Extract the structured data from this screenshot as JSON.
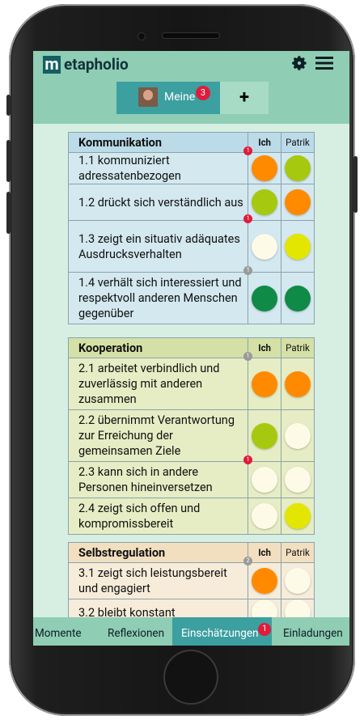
{
  "app": {
    "logo_letter": "m",
    "logo_text": "etapholio",
    "icons": {
      "settings": "gear-icon",
      "menu": "hamburger-icon",
      "avatar": "user-avatar"
    }
  },
  "tabs": {
    "meine_label": "Meine",
    "meine_badge": "3",
    "add_label": "+"
  },
  "colors": {
    "orange": "#ff8a00",
    "yellowgreen": "#a6c90f",
    "green": "#0f8a47",
    "yellow": "#e3e600",
    "empty": "#fdfbe8",
    "badge_red": "#e01b3c",
    "badge_grey": "#9a9a9a"
  },
  "sections": [
    {
      "title": "Kommunikation",
      "col_ich": "Ich",
      "col_other": "Patrik",
      "bg": "#d3e8ef",
      "header_bg": "#bcdbe8",
      "items": [
        {
          "text": "1.1 kommuniziert adressatenbezogen",
          "badge": "1",
          "badge_color": "red",
          "ich": "orange",
          "other": "yellowgreen"
        },
        {
          "text": "1.2 drückt sich verständlich aus",
          "badge": "",
          "badge_color": "",
          "ich": "yellowgreen",
          "other": "orange"
        },
        {
          "text": "1.3 zeigt ein situativ adäquates Ausdrucksverhalten",
          "badge": "1",
          "badge_color": "red",
          "ich": "empty",
          "other": "yellow"
        },
        {
          "text": "1.4 verhält sich interessiert und respektvoll anderen Menschen gegenüber",
          "badge": "1",
          "badge_color": "grey",
          "ich": "green",
          "other": "green"
        }
      ]
    },
    {
      "title": "Kooperation",
      "col_ich": "Ich",
      "col_other": "Patrik",
      "bg": "#e6edc4",
      "header_bg": "#d5e0a6",
      "items": [
        {
          "text": "2.1 arbeitet verbindlich und zuverlässig mit anderen zusammen",
          "badge": "1",
          "badge_color": "grey",
          "ich": "orange",
          "other": "orange"
        },
        {
          "text": "2.2 übernimmt Verantwortung zur Erreichung der gemeinsamen Ziele",
          "badge": "",
          "badge_color": "",
          "ich": "yellowgreen",
          "other": "empty"
        },
        {
          "text": "2.3 kann sich in andere Personen hineinversetzen",
          "badge": "1",
          "badge_color": "red",
          "ich": "empty",
          "other": "empty"
        },
        {
          "text": "2.4 zeigt sich offen und kompromissbereit",
          "badge": "",
          "badge_color": "",
          "ich": "empty",
          "other": "yellow"
        }
      ]
    },
    {
      "title": "Selbstregulation",
      "col_ich": "Ich",
      "col_other": "Patrik",
      "bg": "#f6ecd9",
      "header_bg": "#f2dfc0",
      "items": [
        {
          "text": "3.1 zeigt sich leistungsbereit und engagiert",
          "badge": "2",
          "badge_color": "grey",
          "ich": "orange",
          "other": "empty"
        },
        {
          "text": "3.2 bleibt konstant",
          "badge": "",
          "badge_color": "",
          "ich": "empty",
          "other": "empty"
        }
      ]
    }
  ],
  "bottom_nav": [
    {
      "label": "Momente",
      "active": false,
      "badge": ""
    },
    {
      "label": "Reflexionen",
      "active": false,
      "badge": ""
    },
    {
      "label": "Einschätzungen",
      "active": true,
      "badge": "1"
    },
    {
      "label": "Einladungen",
      "active": false,
      "badge": ""
    }
  ]
}
